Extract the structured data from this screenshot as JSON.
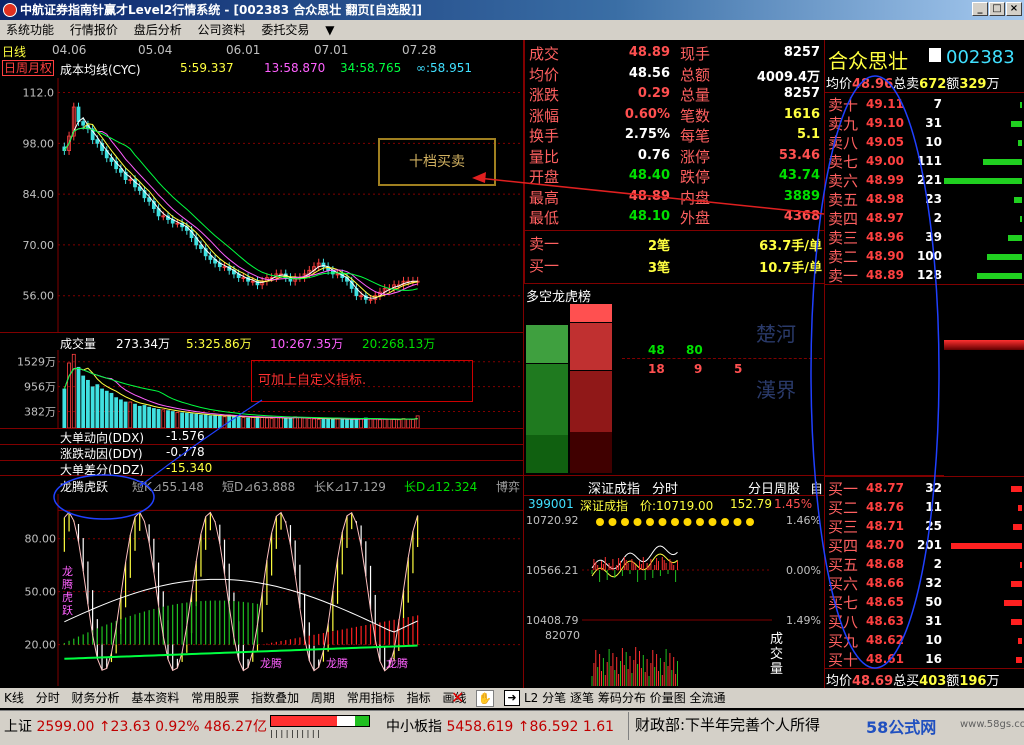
{
  "window": {
    "title": "中航证券指南针赢才Level2行情系统 - [002383 合众思壮 翻页[自选股]]",
    "min": "_",
    "max": "□",
    "close": "×"
  },
  "menu": [
    "系统功能",
    "行情报价",
    "盘后分析",
    "公司资料",
    "委托交易",
    "▼"
  ],
  "kline": {
    "period": "日线",
    "dates": [
      "04.06",
      "05.04",
      "06.01",
      "07.01",
      "07.28"
    ],
    "tabs": [
      "日",
      "周",
      "月",
      "权"
    ],
    "indicator": "成本均线(CYC)",
    "ma": [
      {
        "label": "5:59.337",
        "color": "#ffff40"
      },
      {
        "label": "13:58.870",
        "color": "#ff60ff"
      },
      {
        "label": "34:58.765",
        "color": "#00ff40"
      },
      {
        "label": "∞:58.951",
        "color": "#40e0ff"
      }
    ],
    "yticks": [
      "112.0",
      "98.00",
      "84.00",
      "70.00",
      "56.00"
    ],
    "closes": [
      96,
      100,
      108,
      104,
      103,
      102,
      99,
      98,
      96,
      94,
      93,
      91,
      90,
      88,
      88,
      86,
      85,
      83,
      82,
      80,
      78,
      78,
      77,
      76,
      76,
      75,
      74,
      72,
      70,
      69,
      67,
      66,
      65,
      64,
      64,
      63,
      62,
      61,
      61,
      60,
      60,
      59,
      60,
      61,
      61,
      62,
      62,
      61,
      60,
      61,
      61,
      62,
      63,
      64,
      65,
      64,
      63,
      62,
      62,
      61,
      60,
      58,
      56,
      56,
      55,
      55,
      56,
      57,
      58,
      58,
      59,
      59,
      60,
      60,
      60,
      60
    ],
    "ylim": [
      46,
      116
    ]
  },
  "volume": {
    "title": "成交量",
    "v1": "273.34万",
    "v2": "5:325.86万",
    "v3": "10:267.35万",
    "v4": "20:268.13万",
    "yticks": [
      "1529万",
      "956万",
      "382万"
    ],
    "ylim": [
      0,
      1800
    ],
    "values": [
      900,
      1500,
      1700,
      1400,
      1200,
      1100,
      950,
      1000,
      900,
      850,
      800,
      700,
      650,
      600,
      600,
      550,
      500,
      520,
      480,
      450,
      430,
      420,
      400,
      380,
      360,
      350,
      340,
      330,
      320,
      300,
      300,
      280,
      290,
      270,
      260,
      300,
      260,
      250,
      240,
      230,
      250,
      260,
      240,
      230,
      220,
      250,
      240,
      220,
      230,
      260,
      240,
      230,
      220,
      210,
      200,
      230,
      220,
      210,
      210,
      200,
      200,
      190,
      210,
      220,
      230,
      210,
      200,
      190,
      200,
      210,
      200,
      190,
      220,
      210,
      200,
      280
    ]
  },
  "ddx": [
    {
      "name": "大单动向(DDX)",
      "value": "-1.576"
    },
    {
      "name": "涨跌动因(DDY)",
      "value": "-0.778"
    },
    {
      "name": "大单差分(DDZ)",
      "value": "-15.340"
    }
  ],
  "dragon": {
    "title": "龙腾虎跃",
    "fields": [
      {
        "label": "短K⊿55.148",
        "color": "#a0a0a0"
      },
      {
        "label": "短D⊿63.888",
        "color": "#a0a0a0"
      },
      {
        "label": "长K⊿17.129",
        "color": "#a0a0a0"
      },
      {
        "label": "长D⊿12.324",
        "color": "#00ff40"
      },
      {
        "label": "博弈",
        "color": "#a0a0a0"
      }
    ],
    "yticks": [
      "80.00",
      "50.00",
      "20.00"
    ],
    "side_text": "龙腾虎跃",
    "tag": "龙腾"
  },
  "annot1": "可加上自定义指标.",
  "annot2": "十档买卖",
  "quote": [
    {
      "l": "成交",
      "v": "48.89",
      "c": "#ff5050",
      "l2": "现手",
      "v2": "8257",
      "c2": "#ffffff"
    },
    {
      "l": "均价",
      "v": "48.56",
      "c": "#ffffff",
      "l2": "总额",
      "v2": "4009.4万",
      "c2": "#ffffff"
    },
    {
      "l": "涨跌",
      "v": "0.29",
      "c": "#ff5050",
      "l2": "总量",
      "v2": "8257",
      "c2": "#ffffff"
    },
    {
      "l": "涨幅",
      "v": "0.60%",
      "c": "#ff5050",
      "l2": "笔数",
      "v2": "1616",
      "c2": "#ffff40"
    },
    {
      "l": "换手",
      "v": "2.75%",
      "c": "#ffffff",
      "l2": "每笔",
      "v2": "5.1",
      "c2": "#ffff40"
    },
    {
      "l": "量比",
      "v": "0.76",
      "c": "#ffffff",
      "l2": "涨停",
      "v2": "53.46",
      "c2": "#ff5050"
    },
    {
      "l": "开盘",
      "v": "48.40",
      "c": "#00e000",
      "l2": "跌停",
      "v2": "43.74",
      "c2": "#00e000"
    },
    {
      "l": "最高",
      "v": "48.89",
      "c": "#ff5050",
      "l2": "内盘",
      "v2": "3889",
      "c2": "#00e000"
    },
    {
      "l": "最低",
      "v": "48.10",
      "c": "#00e000",
      "l2": "外盘",
      "v2": "4368",
      "c2": "#ff5050"
    }
  ],
  "sell1": {
    "l": "卖一",
    "n": "2笔",
    "v": "63.7手/单"
  },
  "buy1": {
    "l": "买一",
    "n": "3笔",
    "v": "10.7手/单"
  },
  "dragonlist": {
    "title": "多空龙虎榜",
    "n1": "48",
    "n2": "80",
    "n3": "18",
    "n4": "9",
    "n5": "5",
    "w1": "楚河",
    "w2": "漢界"
  },
  "stock": {
    "name": "合众思壮",
    "code": "002383",
    "avg": "均价",
    "avgv": "48.96",
    "tot": "总卖",
    "totv": "672",
    "amt": "额",
    "amtv": "329",
    "unit": "万"
  },
  "sells": [
    {
      "l": "卖十",
      "p": "49.11",
      "v": "7"
    },
    {
      "l": "卖九",
      "p": "49.10",
      "v": "31"
    },
    {
      "l": "卖八",
      "p": "49.05",
      "v": "10"
    },
    {
      "l": "卖七",
      "p": "49.00",
      "v": "111"
    },
    {
      "l": "卖六",
      "p": "48.99",
      "v": "221"
    },
    {
      "l": "卖五",
      "p": "48.98",
      "v": "23"
    },
    {
      "l": "卖四",
      "p": "48.97",
      "v": "2"
    },
    {
      "l": "卖三",
      "p": "48.96",
      "v": "39"
    },
    {
      "l": "卖二",
      "p": "48.90",
      "v": "100"
    },
    {
      "l": "卖一",
      "p": "48.89",
      "v": "128"
    }
  ],
  "buys": [
    {
      "l": "买一",
      "p": "48.77",
      "v": "32"
    },
    {
      "l": "买二",
      "p": "48.76",
      "v": "11"
    },
    {
      "l": "买三",
      "p": "48.71",
      "v": "25"
    },
    {
      "l": "买四",
      "p": "48.70",
      "v": "201"
    },
    {
      "l": "买五",
      "p": "48.68",
      "v": "2"
    },
    {
      "l": "买六",
      "p": "48.66",
      "v": "32"
    },
    {
      "l": "买七",
      "p": "48.65",
      "v": "50"
    },
    {
      "l": "买八",
      "p": "48.63",
      "v": "31"
    },
    {
      "l": "买九",
      "p": "48.62",
      "v": "10"
    },
    {
      "l": "买十",
      "p": "48.61",
      "v": "16"
    }
  ],
  "bottom_stock": {
    "avg": "均价",
    "avgv": "48.69",
    "tot": "总买",
    "totv": "403",
    "amt": "额",
    "amtv": "196",
    "unit": "万"
  },
  "index": {
    "tab1": "深证成指",
    "tab2": "分时",
    "tab3": "分日周股",
    "tab4": "自",
    "code": "399001",
    "name": "深证成指",
    "price": "价:10719.00",
    "chg": "152.79",
    "pct": "1.45%",
    "y1": "10720.92",
    "y2": "10566.21",
    "y3": "10408.79",
    "p1": "1.46%",
    "p2": "0.00%",
    "p3": "1.49%",
    "vol": "82070",
    "vlabel": "成交量"
  },
  "bottombar": [
    "K线",
    "分时",
    "财务分析",
    "基本资料",
    "常用股票",
    "指数叠加",
    "周期",
    "常用指标",
    "指标",
    "画线"
  ],
  "bottombar2": [
    "L2",
    "分笔",
    "逐笔",
    "筹码分布",
    "价量图",
    "全流通"
  ],
  "status": {
    "sh": "上证",
    "shv": "2599.00",
    "shc": "↑23.63",
    "shp": "0.92%",
    "sha": "486.27亿",
    "zx": "中小板指",
    "zxv": "5458.619",
    "zxc": "↑86.592",
    "zxp": "1.61",
    "news": "财政部:下半年完善个人所得",
    "logo": "58公式网",
    "url": "www.58gs.com"
  }
}
